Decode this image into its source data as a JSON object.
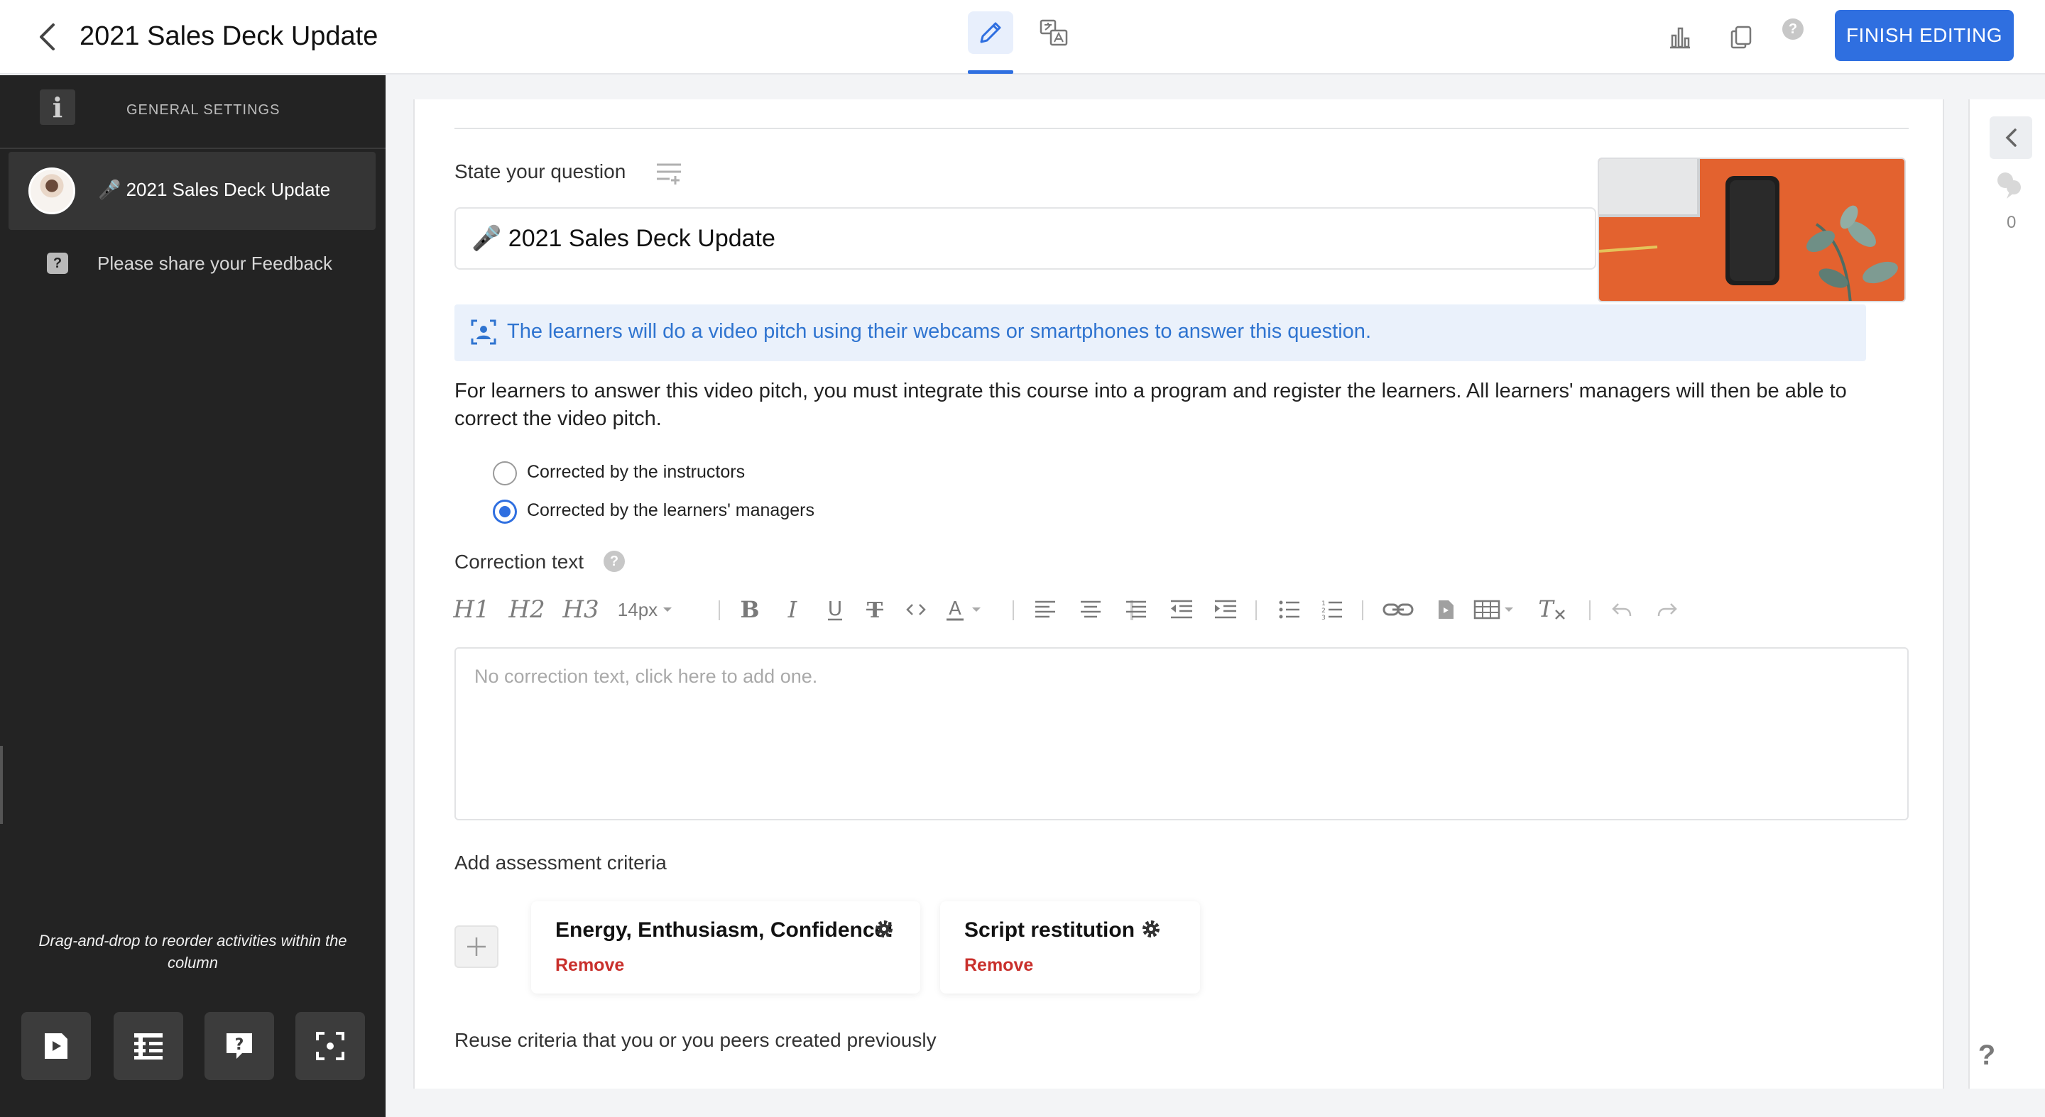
{
  "header": {
    "title": "2021 Sales Deck Update",
    "finish_label": "FINISH EDITING",
    "help_glyph": "?"
  },
  "sidebar": {
    "settings_label": "GENERAL SETTINGS",
    "info_glyph": "i",
    "items": [
      {
        "label": "🎤 2021 Sales Deck Update",
        "active": true
      },
      {
        "label": "Please share your Feedback",
        "icon_glyph": "?"
      }
    ],
    "hint": "Drag-and-drop to reorder activities within the column"
  },
  "question": {
    "label": "State your question",
    "value": "🎤 2021 Sales Deck Update",
    "info": "The learners will do a video pitch using their webcams or smartphones to answer this question.",
    "description": "For learners to answer this video pitch, you must integrate this course into a program and register the learners. All learners' managers will then be able to correct the video pitch."
  },
  "correction_options": [
    {
      "label": "Corrected by the instructors",
      "checked": false
    },
    {
      "label": "Corrected by the learners' managers",
      "checked": true
    }
  ],
  "correction": {
    "label": "Correction text",
    "help_glyph": "?",
    "placeholder": "No correction text, click here to add one."
  },
  "toolbar": {
    "h1": "H1",
    "h2": "H2",
    "h3": "H3",
    "font_size": "14px"
  },
  "assessment": {
    "label": "Add assessment criteria",
    "criteria": [
      {
        "name": "Energy, Enthusiasm, Confidence!",
        "remove_label": "Remove"
      },
      {
        "name": "Script restitution",
        "remove_label": "Remove"
      }
    ],
    "reuse_label": "Reuse criteria that you or you peers created previously"
  },
  "rail": {
    "comment_count": "0",
    "help_glyph": "?"
  },
  "colors": {
    "accent": "#2f6fe0",
    "sidebar_bg": "#232323",
    "remove": "#c9302c",
    "info_bg": "#eaf1fb"
  }
}
